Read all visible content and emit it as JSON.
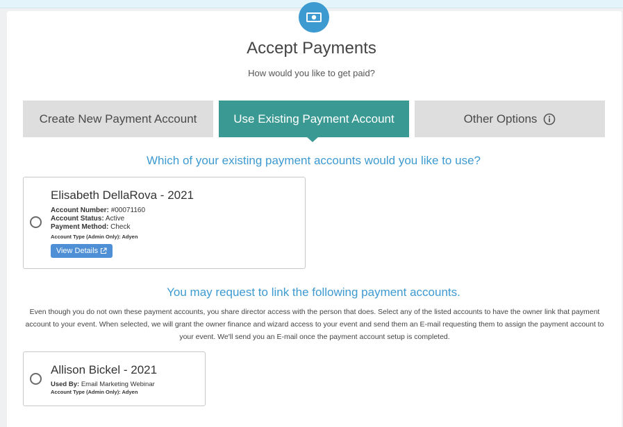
{
  "header": {
    "title": "Accept Payments",
    "subtitle": "How would you like to get paid?",
    "icon": "money-icon",
    "accent_color": "#3d9ad1"
  },
  "tabs": [
    {
      "label": "Create New Payment Account",
      "active": false
    },
    {
      "label": "Use Existing Payment Account",
      "active": true
    },
    {
      "label": "Other Options",
      "active": false,
      "icon": "info-icon"
    }
  ],
  "existing": {
    "heading": "Which of your existing payment accounts would you like to use?",
    "account": {
      "name": "Elisabeth DellaRova - 2021",
      "number_label": "Account Number:",
      "number_value": "#00071160",
      "status_label": "Account Status:",
      "status_value": "Active",
      "method_label": "Payment Method:",
      "method_value": "Check",
      "type_label": "Account Type (Admin Only):",
      "type_value": "Adyen",
      "view_details_label": "View Details",
      "selected": false
    }
  },
  "link": {
    "heading": "You may request to link the following payment accounts.",
    "description": "Even though you do not own these payment accounts, you share director access with the person that does. Select any of the listed accounts to have the owner link that payment account to your event. When selected, we will grant the owner finance and wizard access to your event and send them an E-mail requesting them to assign the payment account to your event. We'll send you an E-mail once the payment account setup is completed.",
    "account": {
      "name": "Allison Bickel - 2021",
      "used_by_label": "Used By:",
      "used_by_value": "Email Marketing Webinar",
      "type_label": "Account Type (Admin Only):",
      "type_value": "Adyen",
      "selected": false
    }
  },
  "colors": {
    "tab_active": "#3a9a93",
    "tab_inactive": "#dedede",
    "button": "#4f8fd6"
  }
}
